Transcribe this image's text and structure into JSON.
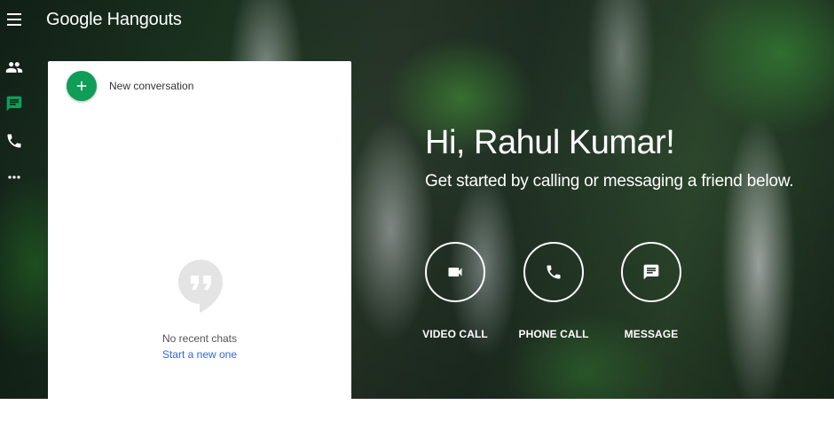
{
  "app": {
    "title": "Google Hangouts"
  },
  "nav": {
    "items": [
      {
        "name": "contacts",
        "icon": "people-icon"
      },
      {
        "name": "conversations",
        "icon": "chat-icon",
        "active": true,
        "color": "#0f9d58"
      },
      {
        "name": "phone-calls",
        "icon": "phone-icon"
      },
      {
        "name": "more",
        "icon": "more-horiz-icon"
      }
    ]
  },
  "panel": {
    "new_conversation_label": "New conversation",
    "empty_state_text": "No recent chats",
    "start_link_text": "Start a new one"
  },
  "main": {
    "greeting": "Hi, Rahul Kumar!",
    "subtitle": "Get started by calling or messaging a friend below.",
    "actions": [
      {
        "label": "VIDEO CALL",
        "icon": "videocam-icon"
      },
      {
        "label": "PHONE CALL",
        "icon": "phone-icon"
      },
      {
        "label": "MESSAGE",
        "icon": "message-icon"
      }
    ]
  },
  "colors": {
    "accent_green": "#0f9d58",
    "link_blue": "#3367d6"
  }
}
